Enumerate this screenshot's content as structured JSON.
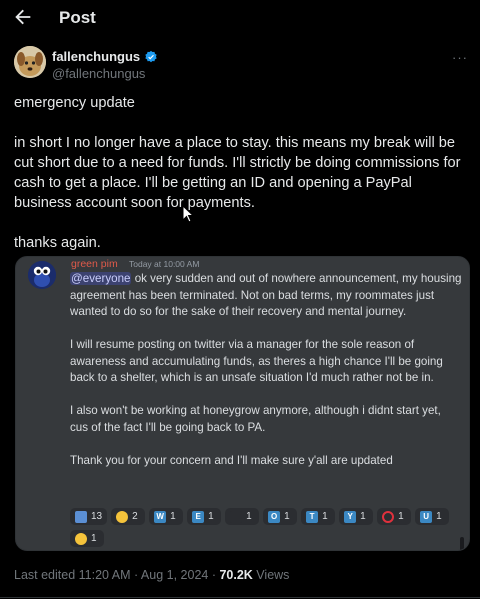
{
  "header": {
    "title": "Post"
  },
  "author": {
    "display_name": "fallenchungus",
    "handle": "@fallenchungus"
  },
  "post": {
    "text": "emergency update\n\nin short I no longer have a place to stay. this means my break will be cut short due to a need for funds. I'll strictly be doing commissions for cash to get a place. I'll be getting an ID and opening a PayPal business account soon for payments.\n\nthanks again."
  },
  "embed": {
    "username": "green pim",
    "timestamp": "Today at 10:00 AM",
    "mention": "@everyone",
    "message": " ok very sudden and out of nowhere announcement, my housing agreement has been terminated. Not on bad terms, my roommates just wanted to do so for the sake of their recovery and mental journey.\n\nI will resume posting on twitter via a manager for the sole reason of awareness and accumulating funds, as theres a high chance I'll be going back to a shelter, which is an unsafe situation I'd much rather not be in.\n\nI also won't be working at honeygrow anymore, although i didnt start yet, cus of the fact I'll be going back to PA.\n\nThank you for your concern and I'll make sure y'all are updated",
    "reactions": [
      {
        "icon": "water-emoji-icon",
        "kind": "emoji",
        "color": "#5b8fd4",
        "count": "13"
      },
      {
        "icon": "face-emoji-icon",
        "kind": "face",
        "color": "#f5c33b",
        "count": "2"
      },
      {
        "icon": "letter-w-icon",
        "kind": "letter",
        "letter": "W",
        "count": "1"
      },
      {
        "icon": "letter-e-icon",
        "kind": "letter",
        "letter": "E",
        "count": "1"
      },
      {
        "icon": "blank-emoji-icon",
        "kind": "emoji",
        "color": "#2b2d31",
        "count": "1"
      },
      {
        "icon": "letter-o-icon",
        "kind": "letter",
        "letter": "O",
        "count": "1"
      },
      {
        "icon": "letter-t-icon",
        "kind": "letter",
        "letter": "T",
        "count": "1"
      },
      {
        "icon": "letter-y-icon",
        "kind": "letter",
        "letter": "Y",
        "count": "1"
      },
      {
        "icon": "red-circle-icon",
        "kind": "ring",
        "color": "#e0313d",
        "count": "1"
      },
      {
        "icon": "letter-u-icon",
        "kind": "letter",
        "letter": "U",
        "count": "1"
      },
      {
        "icon": "sad-face-emoji-icon",
        "kind": "face",
        "color": "#f5c33b",
        "count": "1"
      }
    ]
  },
  "footer": {
    "edited": "Last edited 11:20 AM · Aug 1, 2024 · ",
    "views_count": "70.2K",
    "views_label": " Views"
  },
  "colors": {
    "background": "#000000",
    "verified": "#1d9bf0",
    "embed_bg": "#36393c",
    "mention_bg": "#3c4270",
    "discord_name": "#e05a4a"
  }
}
